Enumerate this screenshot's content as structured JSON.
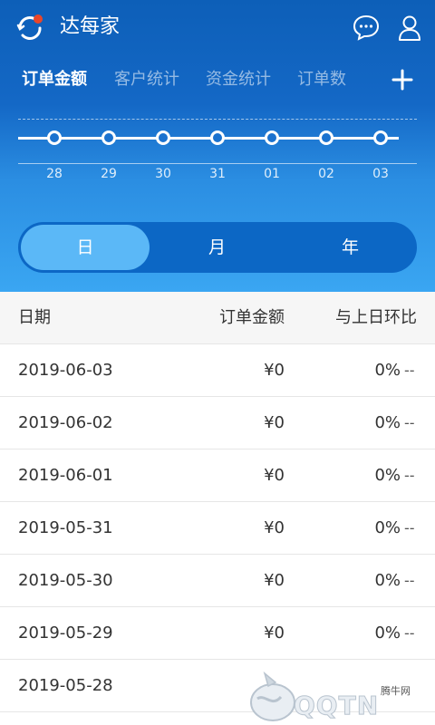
{
  "app": {
    "title": "达每家"
  },
  "tabs": [
    {
      "label": "订单金额",
      "active": true
    },
    {
      "label": "客户统计",
      "active": false
    },
    {
      "label": "资金统计",
      "active": false
    },
    {
      "label": "订单数",
      "active": false
    }
  ],
  "timeline": {
    "labels": [
      "28",
      "29",
      "30",
      "31",
      "01",
      "02",
      "03"
    ]
  },
  "period": {
    "options": [
      "日",
      "月",
      "年"
    ],
    "selected": "日"
  },
  "table": {
    "headers": {
      "date": "日期",
      "amount": "订单金额",
      "ratio": "与上日环比"
    },
    "rows": [
      {
        "date": "2019-06-03",
        "amount": "¥0",
        "ratio": "0%",
        "trend": "--"
      },
      {
        "date": "2019-06-02",
        "amount": "¥0",
        "ratio": "0%",
        "trend": "--"
      },
      {
        "date": "2019-06-01",
        "amount": "¥0",
        "ratio": "0%",
        "trend": "--"
      },
      {
        "date": "2019-05-31",
        "amount": "¥0",
        "ratio": "0%",
        "trend": "--"
      },
      {
        "date": "2019-05-30",
        "amount": "¥0",
        "ratio": "0%",
        "trend": "--"
      },
      {
        "date": "2019-05-29",
        "amount": "¥0",
        "ratio": "0%",
        "trend": "--"
      },
      {
        "date": "2019-05-28",
        "amount": "",
        "ratio": "",
        "trend": ""
      }
    ]
  },
  "watermark": {
    "text": "QQTN",
    "small": "腾牛网"
  },
  "colors": {
    "header_dark": "#0d5fb8",
    "header_light": "#3aa6f2",
    "segment_active": "#5bb8f7",
    "accent_dot": "#e8462a"
  }
}
